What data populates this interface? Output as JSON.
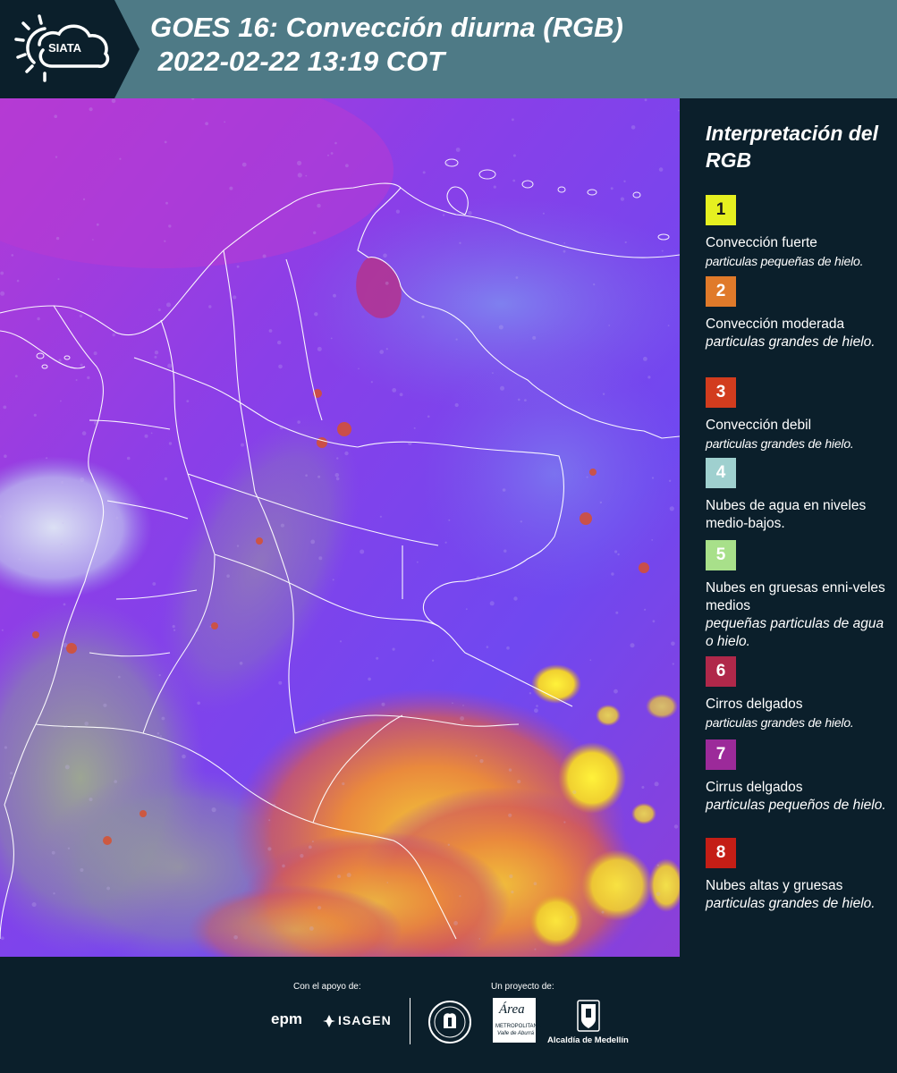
{
  "header": {
    "logo_text": "SIATA",
    "title_line1": "GOES 16: Convección diurna (RGB)",
    "title_line2": " 2022-02-22 13:19 COT"
  },
  "legend": {
    "title": "Interpretación del RGB",
    "items": [
      {
        "number": "1",
        "color": "#e6f020",
        "number_color": "#1a1a1a",
        "name": "Convección fuerte",
        "desc": "particulas pequeñas de hielo."
      },
      {
        "number": "2",
        "color": "#e07a2a",
        "number_color": "#ffffff",
        "name": "Convección moderada",
        "desc": "particulas grandes de hielo."
      },
      {
        "number": "3",
        "color": "#d23c1e",
        "number_color": "#ffffff",
        "name": "Convección debil",
        "desc": "particulas grandes de hielo."
      },
      {
        "number": "4",
        "color": "#9fd0cf",
        "number_color": "#ffffff",
        "name": "Nubes de agua en niveles medio-bajos.",
        "desc": ""
      },
      {
        "number": "5",
        "color": "#a8e08a",
        "number_color": "#ffffff",
        "name": "Nubes en gruesas enni-veles medios",
        "desc": "pequeñas particulas de agua o hielo."
      },
      {
        "number": "6",
        "color": "#b0284a",
        "number_color": "#ffffff",
        "name": "Cirros delgados",
        "desc": "particulas grandes de hielo."
      },
      {
        "number": "7",
        "color": "#9c2a9a",
        "number_color": "#ffffff",
        "name": "Cirrus delgados",
        "desc": "particulas pequeños de hielo."
      },
      {
        "number": "8",
        "color": "#c41e16",
        "number_color": "#ffffff",
        "name": "Nubes altas y gruesas",
        "desc": "particulas grandes de hielo."
      }
    ]
  },
  "footer": {
    "support_label": "Con el apoyo de:",
    "project_label": "Un proyecto de:",
    "brand_epm": "epm",
    "brand_isagen": "ISAGEN",
    "brand_area": "Área",
    "brand_area_sub1": "METROPOLITANA",
    "brand_area_sub2": "Valle de Aburrá",
    "brand_medellin": "Alcaldía de Medellín"
  },
  "colors": {
    "background": "#0b1f2b",
    "header_band": "#4e7a86",
    "map_base": "#7a3fe6",
    "border_lines": "#ffffff"
  }
}
